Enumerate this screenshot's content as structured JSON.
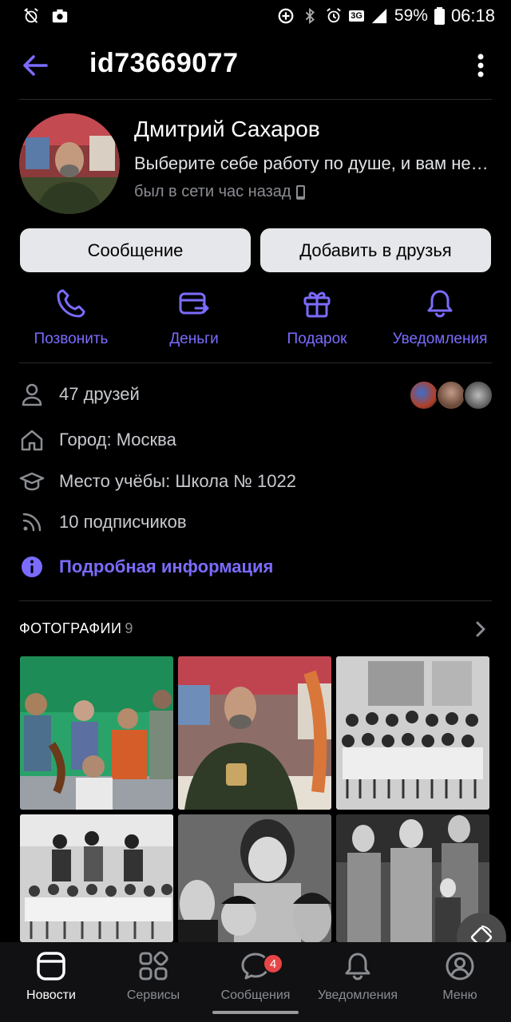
{
  "status_bar": {
    "battery": "59%",
    "time": "06:18",
    "network": "3G"
  },
  "header": {
    "title": "id73669077"
  },
  "profile": {
    "name": "Дмитрий Сахаров",
    "status": "Выберите себе работу по душе, и вам не придётся работать ни одного дня в своей жизни",
    "online": "был в сети час назад"
  },
  "buttons": {
    "message": "Сообщение",
    "add_friend": "Добавить в друзья"
  },
  "actions": [
    {
      "label": "Позвонить",
      "icon": "phone-icon"
    },
    {
      "label": "Деньги",
      "icon": "money-transfer-icon"
    },
    {
      "label": "Подарок",
      "icon": "gift-icon"
    },
    {
      "label": "Уведомления",
      "icon": "bell-icon"
    }
  ],
  "info": {
    "friends": "47 друзей",
    "city": "Город: Москва",
    "school": "Место учёбы: Школа № 1022",
    "followers": "10 подписчиков",
    "details": "Подробная информация"
  },
  "photos": {
    "title": "ФОТОГРАФИИ",
    "count": "9"
  },
  "bottom_nav": {
    "items": [
      {
        "label": "Новости",
        "icon": "news-icon",
        "active": true
      },
      {
        "label": "Сервисы",
        "icon": "services-icon"
      },
      {
        "label": "Сообщения",
        "icon": "messages-icon",
        "badge": "4"
      },
      {
        "label": "Уведомления",
        "icon": "bell-icon"
      },
      {
        "label": "Меню",
        "icon": "profile-icon"
      }
    ]
  },
  "colors": {
    "accent": "#7b6cff",
    "background": "#000000",
    "button_bg": "#e6e7ea",
    "badge": "#e64646"
  }
}
